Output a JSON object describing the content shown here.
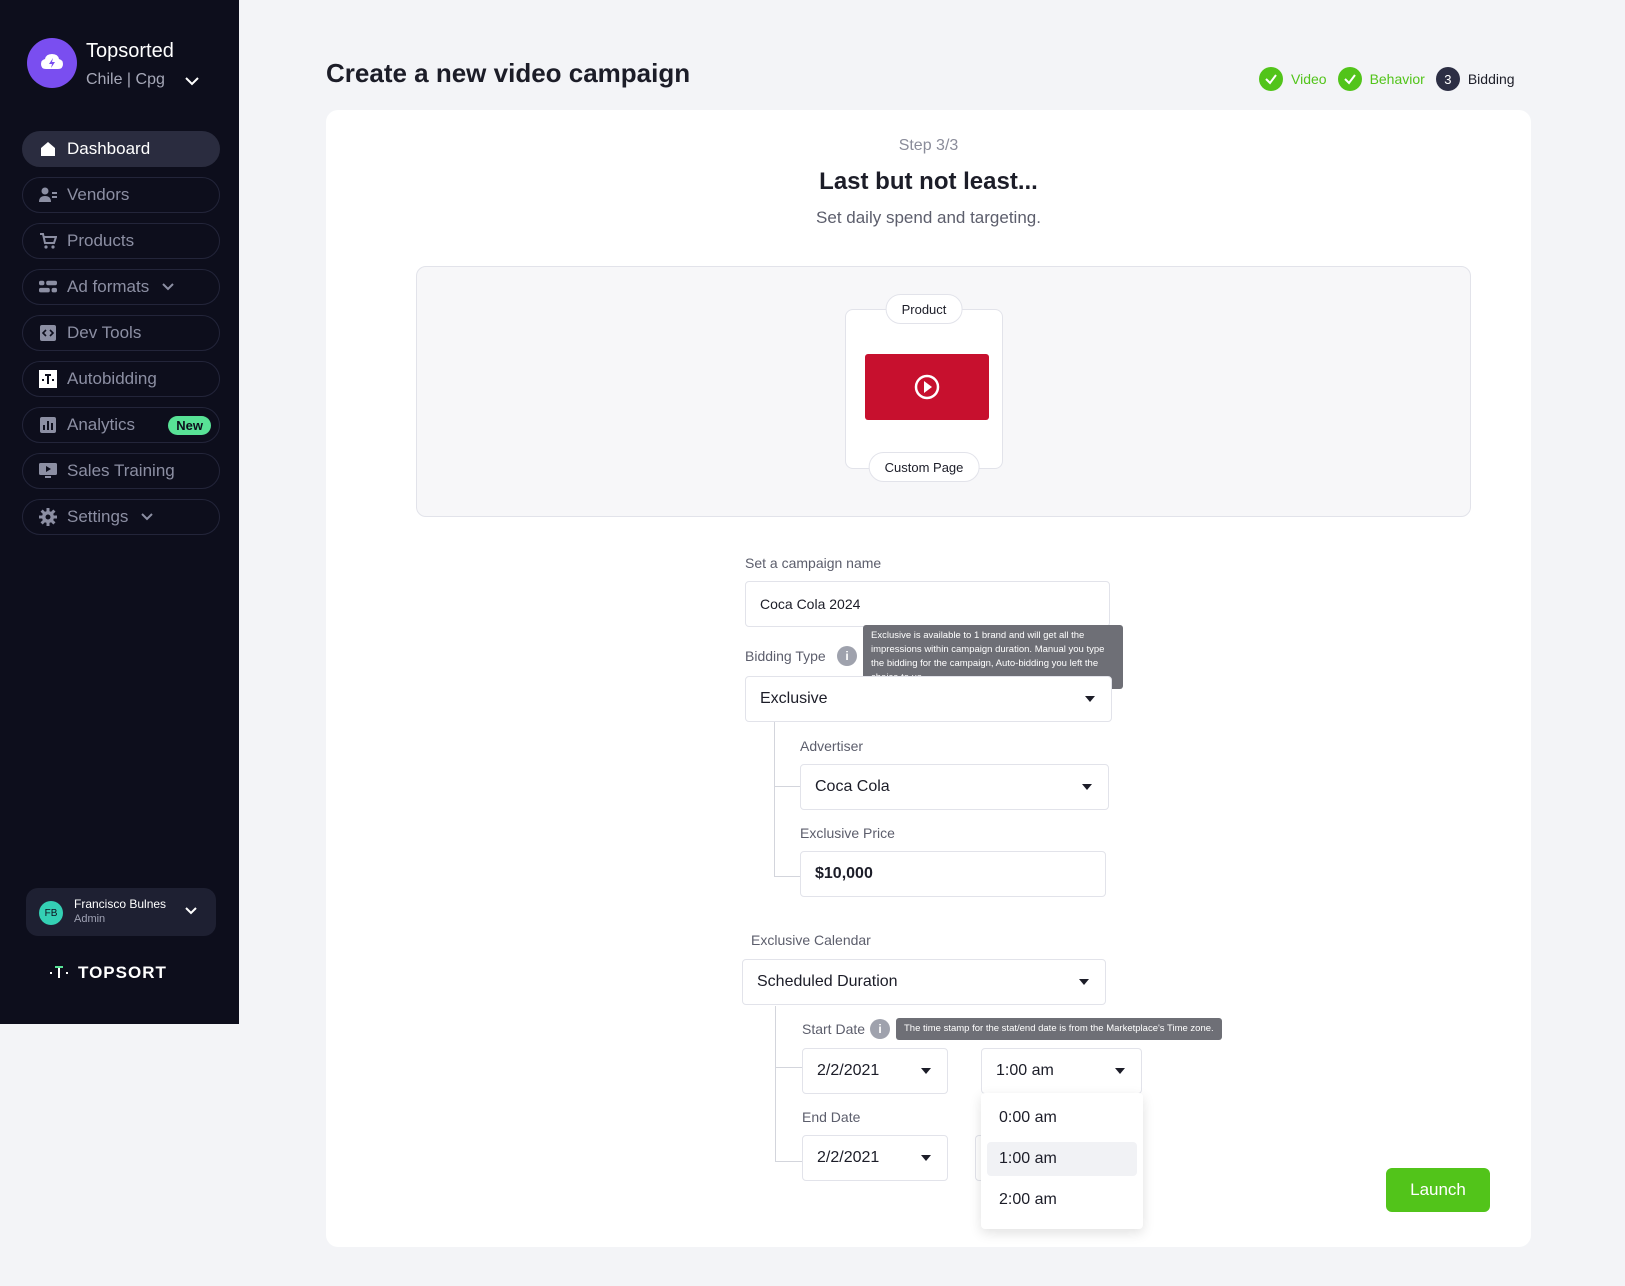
{
  "org": {
    "name": "Topsorted",
    "sub": "Chile | Cpg"
  },
  "nav": [
    {
      "label": "Dashboard",
      "icon": "home-icon"
    },
    {
      "label": "Vendors",
      "icon": "vendors-icon"
    },
    {
      "label": "Products",
      "icon": "cart-icon"
    },
    {
      "label": "Ad formats",
      "icon": "ad-formats-icon"
    },
    {
      "label": "Dev Tools",
      "icon": "code-icon"
    },
    {
      "label": "Autobidding",
      "icon": "autobidding-icon"
    },
    {
      "label": "Analytics",
      "icon": "analytics-icon",
      "badge": "New"
    },
    {
      "label": "Sales Training",
      "icon": "training-icon"
    },
    {
      "label": "Settings",
      "icon": "gear-icon"
    }
  ],
  "user": {
    "initials": "FB",
    "name": "Francisco Bulnes",
    "role": "Admin"
  },
  "brand": "TOPSORT",
  "header": {
    "title": "Create a new video campaign",
    "steps": [
      {
        "label": "Video",
        "state": "done"
      },
      {
        "label": "Behavior",
        "state": "done"
      },
      {
        "label": "Bidding",
        "state": "current",
        "number": "3"
      }
    ]
  },
  "card": {
    "step_count": "Step 3/3",
    "headline": "Last but not least...",
    "subline": "Set daily spend and targeting.",
    "preview": {
      "top_pill": "Product",
      "bottom_pill": "Custom Page"
    }
  },
  "form": {
    "campaign_name_label": "Set a campaign name",
    "campaign_name_value": "Coca Cola 2024",
    "bidding_type_label": "Bidding Type",
    "bidding_type_value": "Exclusive",
    "bidding_tooltip": "Exclusive is available to 1 brand and will get all the impressions within campaign duration. Manual you type the bidding for the campaign, Auto-bidding you left the choice to us.",
    "advertiser_label": "Advertiser",
    "advertiser_value": "Coca Cola",
    "exclusive_price_label": "Exclusive Price",
    "exclusive_price_value": "$10,000",
    "calendar_label": "Exclusive Calendar",
    "calendar_value": "Scheduled Duration",
    "start_date_label": "Start Date",
    "start_date_tooltip": "The time stamp for the stat/end date is from the Marketplace's Time zone.",
    "start_date_value": "2/2/2021",
    "start_time_value": "1:00 am",
    "end_date_label": "End Date",
    "end_date_value": "2/2/2021",
    "time_options": [
      "0:00 am",
      "1:00 am",
      "2:00 am"
    ],
    "launch_label": "Launch"
  },
  "colors": {
    "sidebar_bg": "#0d0e1c",
    "accent_green": "#52c41a",
    "new_badge": "#58e296",
    "org_logo": "#7a4ef0"
  }
}
